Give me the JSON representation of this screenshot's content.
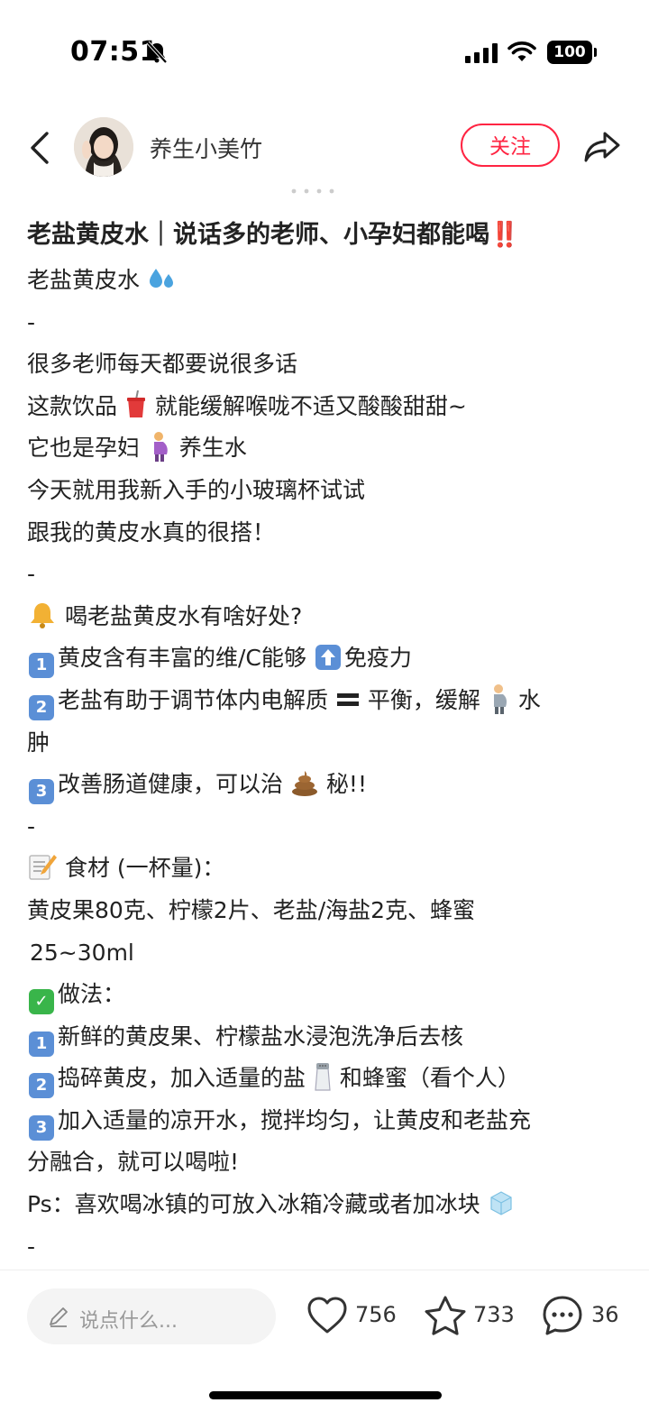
{
  "status_bar": {
    "time": "07:51",
    "battery": "100"
  },
  "author": {
    "name": "养生小美竹",
    "follow_label": "关注"
  },
  "post": {
    "title": "老盐黄皮水｜说话多的老师、小孕妇都能喝",
    "title_emoji": "‼️",
    "lines": {
      "l1": "老盐黄皮水",
      "l2": "-",
      "l3": "很多老师每天都要说很多话",
      "l4a": "这款饮品",
      "l4b": "就能缓解喉咙不适又酸酸甜甜~",
      "l5a": "它也是孕妇",
      "l5b": "养生水",
      "l6": "今天就用我新入手的小玻璃杯试试",
      "l7": "跟我的黄皮水真的很搭！",
      "l8": "-",
      "l9": "喝老盐黄皮水有啥好处?",
      "l10a": "黄皮含有丰富的维/C能够",
      "l10b": "免疫力",
      "l11a": "老盐有助于调节体内电解质",
      "l11b": "平衡，缓解",
      "l11c": "水",
      "l12": "肿",
      "l13a": "改善肠道健康，可以治",
      "l13b": "秘!!",
      "l14": "-",
      "l15": "食材 (一杯量)：",
      "l16": "黄皮果80克、柠檬2片、老盐/海盐2克、蜂蜜",
      "l17": "25~30ml",
      "l18": "做法：",
      "l19": "新鲜的黄皮果、柠檬盐水浸泡洗净后去核",
      "l20a": "捣碎黄皮，加入适量的盐",
      "l20b": "和蜂蜜（看个人）",
      "l21": "加入适量的凉开水，搅拌均匀，让黄皮和老盐充",
      "l22": "分融合，就可以喝啦!",
      "l23a": "Ps：喜欢喝冰镇的可放入冰箱冷藏或者加冰块",
      "l24": "-"
    },
    "keycaps": {
      "one": "1",
      "two": "2",
      "three": "3"
    },
    "check_mark": "✓"
  },
  "bottom_bar": {
    "comment_placeholder": "说点什么...",
    "likes": "756",
    "favorites": "733",
    "comments": "36"
  },
  "icons": {
    "back": "chevron-left-icon",
    "share": "share-arrow-icon",
    "silent": "bell-slash-icon",
    "like": "heart-icon",
    "favorite": "star-icon",
    "comment": "chat-bubble-icon",
    "edit": "pencil-icon"
  },
  "colors": {
    "accent": "#ff2442",
    "text": "#222222",
    "placeholder": "#999999",
    "keycap": "#5b8fd6"
  }
}
